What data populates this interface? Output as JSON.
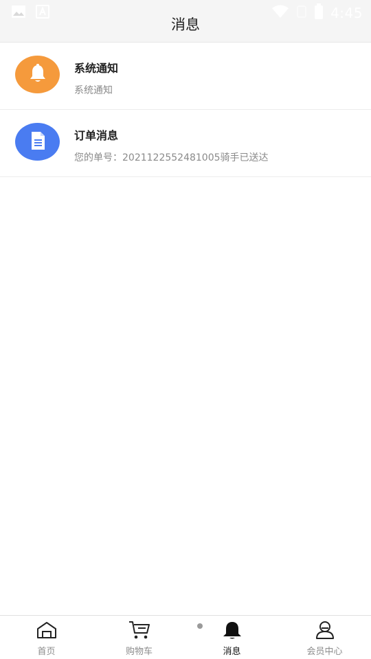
{
  "status_bar": {
    "time": "4:45",
    "icons": [
      "image-icon",
      "a-icon",
      "wifi-icon",
      "sim-icon",
      "battery-icon"
    ]
  },
  "header": {
    "title": "消息"
  },
  "messages": [
    {
      "title": "系统通知",
      "subtitle": "系统通知",
      "icon": "bell-icon",
      "color": "#F59A3C"
    },
    {
      "title": "订单消息",
      "subtitle": "您的单号：2021122552481005骑手已送达",
      "icon": "document-icon",
      "color": "#4A7CF1"
    }
  ],
  "tabbar": {
    "items": [
      {
        "label": "首页",
        "icon": "home-icon"
      },
      {
        "label": "购物车",
        "icon": "cart-icon"
      },
      {
        "label": "消息",
        "icon": "bell-icon",
        "active": true
      },
      {
        "label": "会员中心",
        "icon": "user-icon"
      }
    ]
  }
}
